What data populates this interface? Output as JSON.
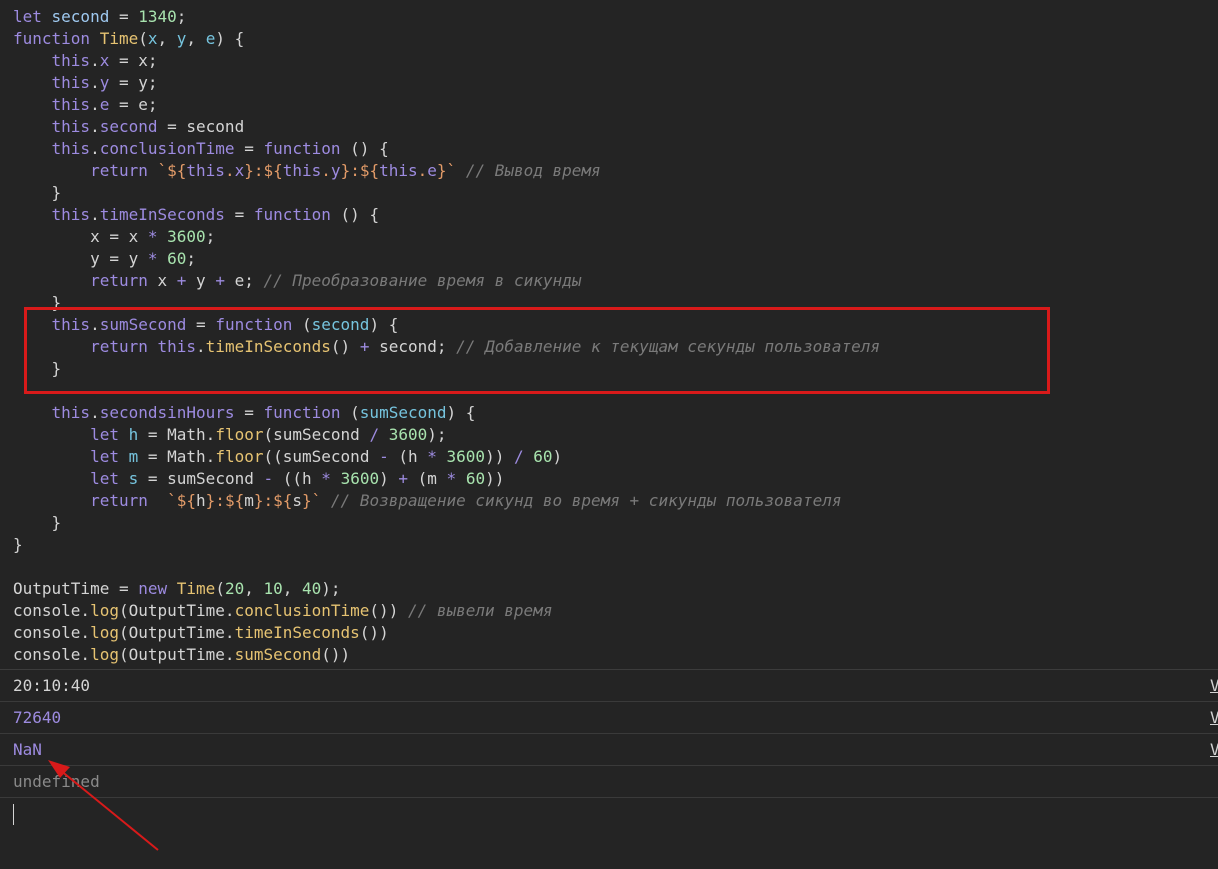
{
  "code_lines": [
    [
      [
        "t-kw",
        "let "
      ],
      [
        "t-var",
        "second"
      ],
      [
        "t-plain",
        " = "
      ],
      [
        "t-num",
        "1340"
      ],
      [
        "t-plain",
        ";"
      ]
    ],
    [
      [
        "t-kw",
        "function "
      ],
      [
        "t-fn",
        "Time"
      ],
      [
        "t-plain",
        "("
      ],
      [
        "t-param",
        "x"
      ],
      [
        "t-plain",
        ", "
      ],
      [
        "t-param",
        "y"
      ],
      [
        "t-plain",
        ", "
      ],
      [
        "t-param",
        "e"
      ],
      [
        "t-plain",
        ") {"
      ]
    ],
    [
      [
        "t-plain",
        "    "
      ],
      [
        "t-kw",
        "this"
      ],
      [
        "t-plain",
        "."
      ],
      [
        "t-prop",
        "x"
      ],
      [
        "t-plain",
        " = x;"
      ]
    ],
    [
      [
        "t-plain",
        "    "
      ],
      [
        "t-kw",
        "this"
      ],
      [
        "t-plain",
        "."
      ],
      [
        "t-prop",
        "y"
      ],
      [
        "t-plain",
        " = y;"
      ]
    ],
    [
      [
        "t-plain",
        "    "
      ],
      [
        "t-kw",
        "this"
      ],
      [
        "t-plain",
        "."
      ],
      [
        "t-prop",
        "e"
      ],
      [
        "t-plain",
        " = e;"
      ]
    ],
    [
      [
        "t-plain",
        "    "
      ],
      [
        "t-kw",
        "this"
      ],
      [
        "t-plain",
        "."
      ],
      [
        "t-prop",
        "second"
      ],
      [
        "t-plain",
        " = second"
      ]
    ],
    [
      [
        "t-plain",
        "    "
      ],
      [
        "t-kw",
        "this"
      ],
      [
        "t-plain",
        "."
      ],
      [
        "t-prop",
        "conclusionTime"
      ],
      [
        "t-plain",
        " = "
      ],
      [
        "t-kw",
        "function"
      ],
      [
        "t-plain",
        " () {"
      ]
    ],
    [
      [
        "t-plain",
        "        "
      ],
      [
        "t-kw",
        "return "
      ],
      [
        "t-str",
        "`${"
      ],
      [
        "t-kw",
        "this"
      ],
      [
        "t-str",
        "."
      ],
      [
        "t-prop",
        "x"
      ],
      [
        "t-str",
        "}:${"
      ],
      [
        "t-kw",
        "this"
      ],
      [
        "t-str",
        "."
      ],
      [
        "t-prop",
        "y"
      ],
      [
        "t-str",
        "}:${"
      ],
      [
        "t-kw",
        "this"
      ],
      [
        "t-str",
        "."
      ],
      [
        "t-prop",
        "e"
      ],
      [
        "t-str",
        "}`"
      ],
      [
        "t-plain",
        " "
      ],
      [
        "t-cmt",
        "// Вывод время"
      ]
    ],
    [
      [
        "t-plain",
        "    }"
      ]
    ],
    [
      [
        "t-plain",
        "    "
      ],
      [
        "t-kw",
        "this"
      ],
      [
        "t-plain",
        "."
      ],
      [
        "t-prop",
        "timeInSeconds"
      ],
      [
        "t-plain",
        " = "
      ],
      [
        "t-kw",
        "function"
      ],
      [
        "t-plain",
        " () {"
      ]
    ],
    [
      [
        "t-plain",
        "        x = x "
      ],
      [
        "t-kw",
        "*"
      ],
      [
        "t-plain",
        " "
      ],
      [
        "t-num",
        "3600"
      ],
      [
        "t-plain",
        ";"
      ]
    ],
    [
      [
        "t-plain",
        "        y = y "
      ],
      [
        "t-kw",
        "*"
      ],
      [
        "t-plain",
        " "
      ],
      [
        "t-num",
        "60"
      ],
      [
        "t-plain",
        ";"
      ]
    ],
    [
      [
        "t-plain",
        "        "
      ],
      [
        "t-kw",
        "return"
      ],
      [
        "t-plain",
        " x "
      ],
      [
        "t-kw",
        "+"
      ],
      [
        "t-plain",
        " y "
      ],
      [
        "t-kw",
        "+"
      ],
      [
        "t-plain",
        " e; "
      ],
      [
        "t-cmt",
        "// Преобразование время в сикунды"
      ]
    ],
    [
      [
        "t-plain",
        "    }"
      ]
    ],
    [
      [
        "t-plain",
        "    "
      ],
      [
        "t-kw",
        "this"
      ],
      [
        "t-plain",
        "."
      ],
      [
        "t-prop",
        "sumSecond"
      ],
      [
        "t-plain",
        " = "
      ],
      [
        "t-kw",
        "function"
      ],
      [
        "t-plain",
        " ("
      ],
      [
        "t-param",
        "second"
      ],
      [
        "t-plain",
        ") {"
      ]
    ],
    [
      [
        "t-plain",
        "        "
      ],
      [
        "t-kw",
        "return this"
      ],
      [
        "t-plain",
        "."
      ],
      [
        "t-fn",
        "timeInSeconds"
      ],
      [
        "t-plain",
        "() "
      ],
      [
        "t-kw",
        "+"
      ],
      [
        "t-plain",
        " second; "
      ],
      [
        "t-cmt",
        "// Добавление к текущам секунды пользователя"
      ]
    ],
    [
      [
        "t-plain",
        "    }"
      ]
    ],
    [],
    [
      [
        "t-plain",
        "    "
      ],
      [
        "t-kw",
        "this"
      ],
      [
        "t-plain",
        "."
      ],
      [
        "t-prop",
        "secondsinHours"
      ],
      [
        "t-plain",
        " = "
      ],
      [
        "t-kw",
        "function"
      ],
      [
        "t-plain",
        " ("
      ],
      [
        "t-param",
        "sumSecond"
      ],
      [
        "t-plain",
        ") {"
      ]
    ],
    [
      [
        "t-plain",
        "        "
      ],
      [
        "t-kw",
        "let"
      ],
      [
        "t-plain",
        " "
      ],
      [
        "t-param",
        "h"
      ],
      [
        "t-plain",
        " = Math."
      ],
      [
        "t-fn",
        "floor"
      ],
      [
        "t-plain",
        "(sumSecond "
      ],
      [
        "t-kw",
        "/"
      ],
      [
        "t-plain",
        " "
      ],
      [
        "t-num",
        "3600"
      ],
      [
        "t-plain",
        ");"
      ]
    ],
    [
      [
        "t-plain",
        "        "
      ],
      [
        "t-kw",
        "let"
      ],
      [
        "t-plain",
        " "
      ],
      [
        "t-param",
        "m"
      ],
      [
        "t-plain",
        " = Math."
      ],
      [
        "t-fn",
        "floor"
      ],
      [
        "t-plain",
        "((sumSecond "
      ],
      [
        "t-kw",
        "-"
      ],
      [
        "t-plain",
        " (h "
      ],
      [
        "t-kw",
        "*"
      ],
      [
        "t-plain",
        " "
      ],
      [
        "t-num",
        "3600"
      ],
      [
        "t-plain",
        ")) "
      ],
      [
        "t-kw",
        "/"
      ],
      [
        "t-plain",
        " "
      ],
      [
        "t-num",
        "60"
      ],
      [
        "t-plain",
        ")"
      ]
    ],
    [
      [
        "t-plain",
        "        "
      ],
      [
        "t-kw",
        "let"
      ],
      [
        "t-plain",
        " "
      ],
      [
        "t-param",
        "s"
      ],
      [
        "t-plain",
        " = sumSecond "
      ],
      [
        "t-kw",
        "-"
      ],
      [
        "t-plain",
        " ((h "
      ],
      [
        "t-kw",
        "*"
      ],
      [
        "t-plain",
        " "
      ],
      [
        "t-num",
        "3600"
      ],
      [
        "t-plain",
        ") "
      ],
      [
        "t-kw",
        "+"
      ],
      [
        "t-plain",
        " (m "
      ],
      [
        "t-kw",
        "*"
      ],
      [
        "t-plain",
        " "
      ],
      [
        "t-num",
        "60"
      ],
      [
        "t-plain",
        "))"
      ]
    ],
    [
      [
        "t-plain",
        "        "
      ],
      [
        "t-kw",
        "return"
      ],
      [
        "t-plain",
        "  "
      ],
      [
        "t-str",
        "`${"
      ],
      [
        "t-plain",
        "h"
      ],
      [
        "t-str",
        "}:${"
      ],
      [
        "t-plain",
        "m"
      ],
      [
        "t-str",
        "}:${"
      ],
      [
        "t-plain",
        "s"
      ],
      [
        "t-str",
        "}`"
      ],
      [
        "t-plain",
        " "
      ],
      [
        "t-cmt",
        "// Возвращение сикунд во время + сикунды пользователя"
      ]
    ],
    [
      [
        "t-plain",
        "    }"
      ]
    ],
    [
      [
        "t-plain",
        "}"
      ]
    ],
    [],
    [
      [
        "t-plain",
        "OutputTime = "
      ],
      [
        "t-kw",
        "new"
      ],
      [
        "t-plain",
        " "
      ],
      [
        "t-fn",
        "Time"
      ],
      [
        "t-plain",
        "("
      ],
      [
        "t-num",
        "20"
      ],
      [
        "t-plain",
        ", "
      ],
      [
        "t-num",
        "10"
      ],
      [
        "t-plain",
        ", "
      ],
      [
        "t-num",
        "40"
      ],
      [
        "t-plain",
        ");"
      ]
    ],
    [
      [
        "t-plain",
        "console."
      ],
      [
        "t-fn",
        "log"
      ],
      [
        "t-plain",
        "(OutputTime."
      ],
      [
        "t-fn",
        "conclusionTime"
      ],
      [
        "t-plain",
        "()) "
      ],
      [
        "t-cmt",
        "// вывели время"
      ]
    ],
    [
      [
        "t-plain",
        "console."
      ],
      [
        "t-fn",
        "log"
      ],
      [
        "t-plain",
        "(OutputTime."
      ],
      [
        "t-fn",
        "timeInSeconds"
      ],
      [
        "t-plain",
        "())"
      ]
    ],
    [
      [
        "t-plain",
        "console."
      ],
      [
        "t-fn",
        "log"
      ],
      [
        "t-plain",
        "(OutputTime."
      ],
      [
        "t-fn",
        "sumSecond"
      ],
      [
        "t-plain",
        "())"
      ]
    ]
  ],
  "console": {
    "outputs": [
      {
        "value": "20:10:40",
        "type": "str",
        "source": "V"
      },
      {
        "value": "72640",
        "type": "num",
        "source": "V"
      },
      {
        "value": "NaN",
        "type": "num",
        "source": "V"
      }
    ],
    "return_value": "undefined"
  },
  "annotations": {
    "highlight_color": "#d81a1a",
    "arrow_color": "#d81a1a"
  }
}
